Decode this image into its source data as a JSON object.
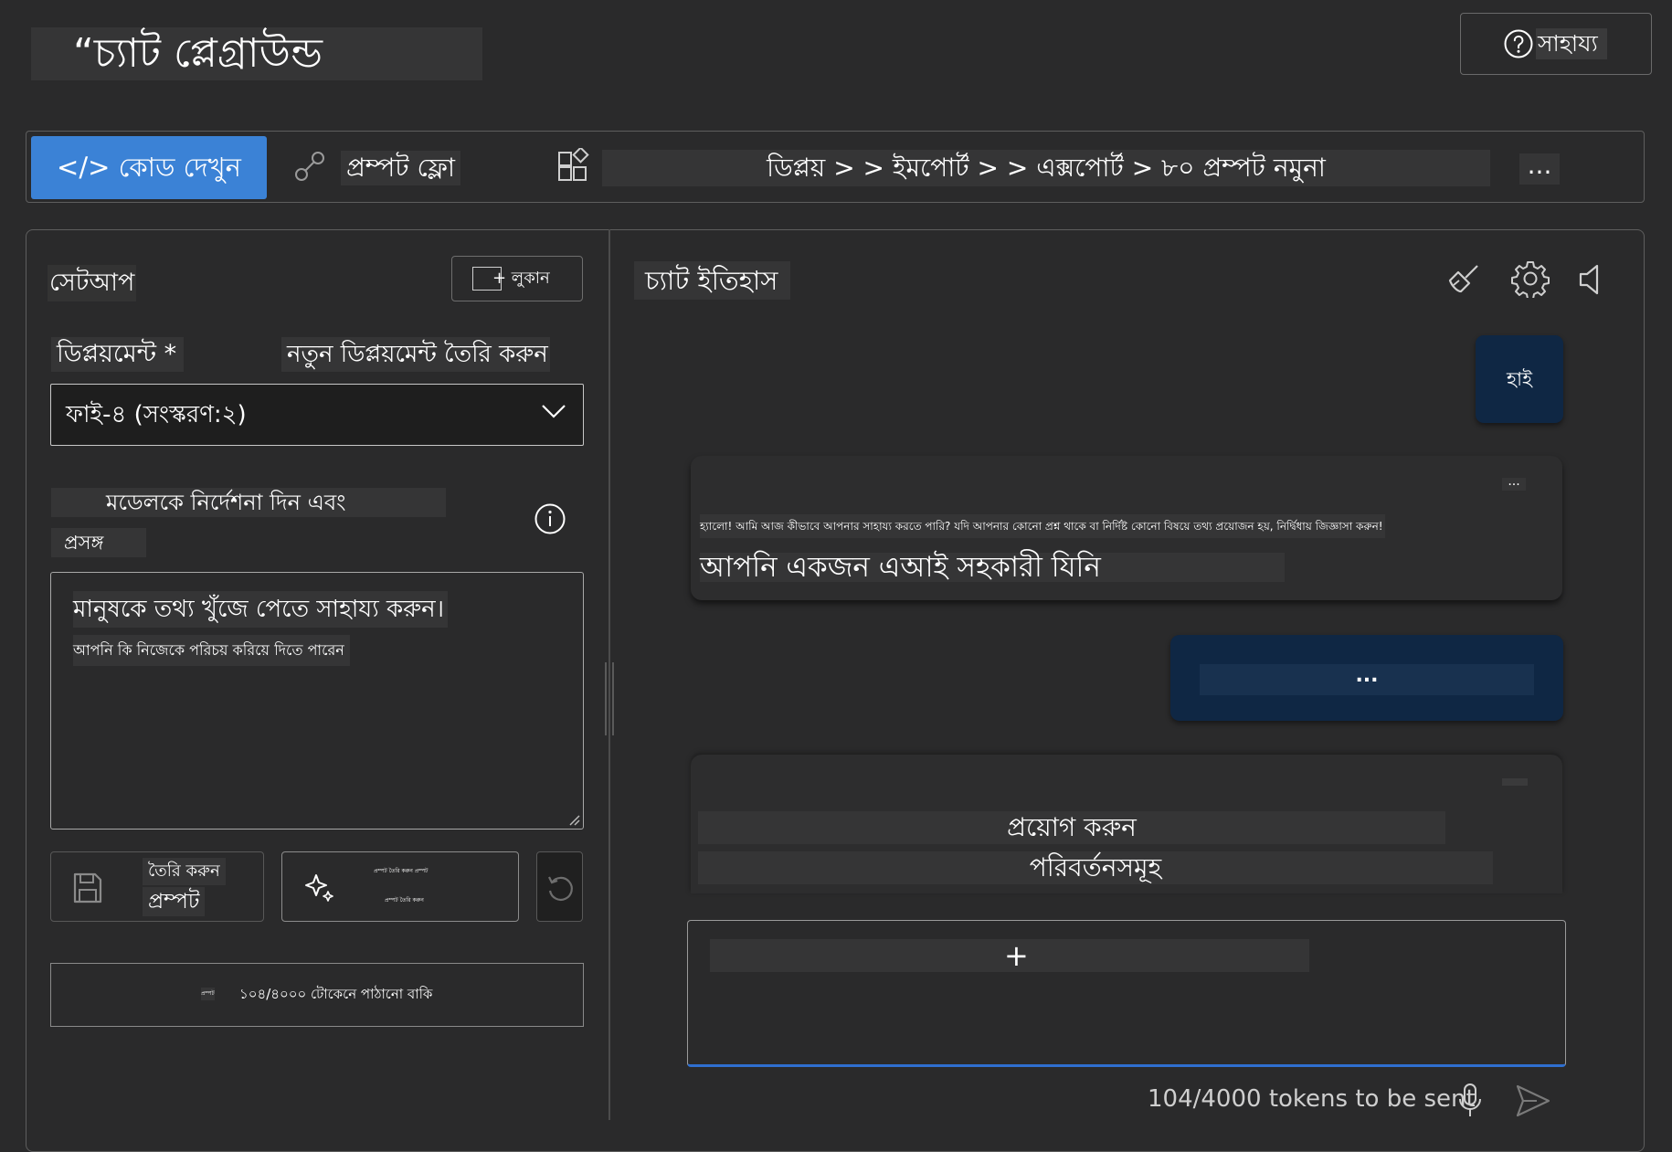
{
  "header": {
    "title": "“চ্যাট প্লেগ্রাউন্ড",
    "help_label": "সাহায্য"
  },
  "toolbar": {
    "code_label": "</> কোড দেখুন",
    "flow_label": "প্রম্পট ফ্লো",
    "breadcrumb": "ডিপ্লয় > > ইমপোর্ট > > এক্সপোর্ট > ৮০ প্রম্পট নমুনা",
    "more_label": "..."
  },
  "setup": {
    "title": "সেটআপ",
    "hide_label": "+ লুকান",
    "deployment_label": "ডিপ্লয়মেন্ট *",
    "new_deployment_label": "নতুন ডিপ্লয়মেন্ট তৈরি করুন",
    "deployment_value": "ফাই-৪ (সংস্করণ:২)",
    "instructions_label_line1": "মডেলকে নির্দেশনা দিন এবং",
    "instructions_label_line2": "প্রসঙ্গ",
    "system_message_line1": "মানুষকে তথ্য খুঁজে পেতে সাহায্য করুন।",
    "system_message_line2": "আপনি কি নিজেকে পরিচয় করিয়ে দিতে পারেন",
    "save_label_line1": "তৈরি করুন",
    "save_label_line2": "প্রম্পট",
    "generate_label_line1": "প্রম্পট তৈরি করুন প্রম্পট",
    "generate_label_line2": "প্রম্পট তৈরি করুন",
    "token_prefix": "প্রম্পট",
    "token_text": "১০৪/৪০০০ টোকেনে পাঠানো বাকি"
  },
  "chat": {
    "title": "চ্যাট ইতিহাস",
    "user_message_1": "হাই",
    "assistant_more": "...",
    "assistant_message_small": "হ্যালো! আমি আজ কীভাবে আপনার সাহায্য করতে পারি? যদি আপনার কোনো প্রশ্ন থাকে বা নির্দিষ্ট কোনো বিষয়ে তথ্য প্রয়োজন হয়, নির্দ্বিধায় জিজ্ঞাসা করুন!",
    "assistant_message_large": "আপনি একজন এআই সহকারী যিনি",
    "user_message_2": "...",
    "assistant_card2_line1": "প্রয়োগ করুন",
    "assistant_card2_line2": "পরিবর্তনসমূহ",
    "input_plus": "+",
    "token_count": "104/4000 tokens to be sent"
  }
}
